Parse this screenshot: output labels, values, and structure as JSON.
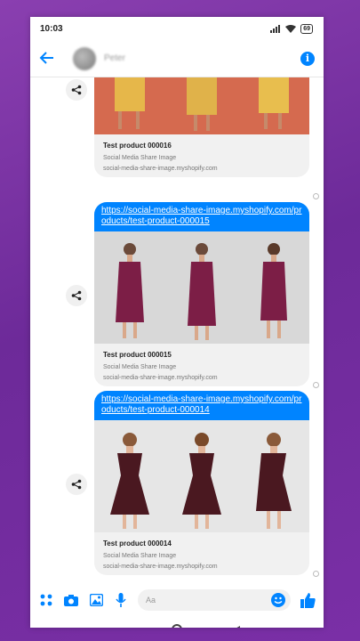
{
  "status_bar": {
    "time": "10:03",
    "battery": "69"
  },
  "header": {
    "contact_name": "Peter"
  },
  "messages": [
    {
      "title": "Test product 000016",
      "subtitle": "Social Media Share Image",
      "site": "social-media-share-image.myshopify.com"
    },
    {
      "link": "https://social-media-share-image.myshopify.com/products/test-product-000015",
      "title": "Test product 000015",
      "subtitle": "Social Media Share Image",
      "site": "social-media-share-image.myshopify.com"
    },
    {
      "link": "https://social-media-share-image.myshopify.com/products/test-product-000014",
      "title": "Test product 000014",
      "subtitle": "Social Media Share Image",
      "site": "social-media-share-image.myshopify.com"
    }
  ],
  "composer": {
    "placeholder": "Aa"
  },
  "colors": {
    "accent": "#0084ff",
    "background": "#7a2fa6"
  }
}
